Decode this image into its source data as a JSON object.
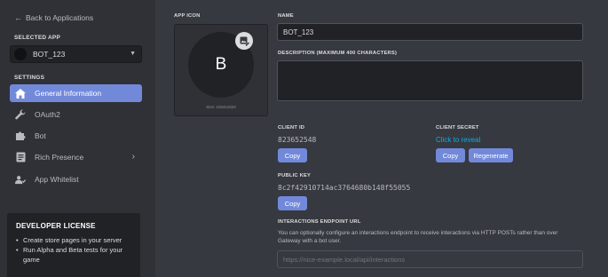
{
  "sidebar": {
    "back_label": "Back to Applications",
    "selected_app_label": "SELECTED APP",
    "selected_app_name": "BOT_123",
    "settings_label": "SETTINGS",
    "items": [
      {
        "label": "General Information",
        "icon": "home-icon",
        "active": true
      },
      {
        "label": "OAuth2",
        "icon": "wrench-icon"
      },
      {
        "label": "Bot",
        "icon": "puzzle-icon"
      },
      {
        "label": "Rich Presence",
        "icon": "document-icon",
        "has_chevron": true
      },
      {
        "label": "App Whitelist",
        "icon": "users-icon"
      }
    ],
    "license": {
      "title": "DEVELOPER LICENSE",
      "bullets": [
        "Create store pages in your server",
        "Run Alpha and Beta tests for your game"
      ]
    }
  },
  "main": {
    "app_icon_label": "APP ICON",
    "app_icon_letter": "B",
    "app_icon_size": "Size: 1024x1024",
    "name_label": "NAME",
    "name_value": "BOT_123",
    "description_label": "DESCRIPTION (MAXIMUM 400 CHARACTERS)",
    "description_value": "",
    "client_id_label": "CLIENT ID",
    "client_id_value": "823652548",
    "client_id_copy": "Copy",
    "client_secret_label": "CLIENT SECRET",
    "client_secret_reveal": "Click to reveal",
    "client_secret_copy": "Copy",
    "client_secret_regenerate": "Regenerate",
    "public_key_label": "PUBLIC KEY",
    "public_key_value": "8c2f42910714ac3764680b148f55055",
    "public_key_copy": "Copy",
    "endpoint_label": "INTERACTIONS ENDPOINT URL",
    "endpoint_help": "You can optionally configure an interactions endpoint to receive interactions via HTTP POSTs rather than over Gateway with a bot user.",
    "endpoint_placeholder": "https://nice-example.local/api/interactions"
  },
  "colors": {
    "accent": "#7289da",
    "link": "#00b0f4",
    "background": "#36393f",
    "sidebar": "#2f3136"
  }
}
